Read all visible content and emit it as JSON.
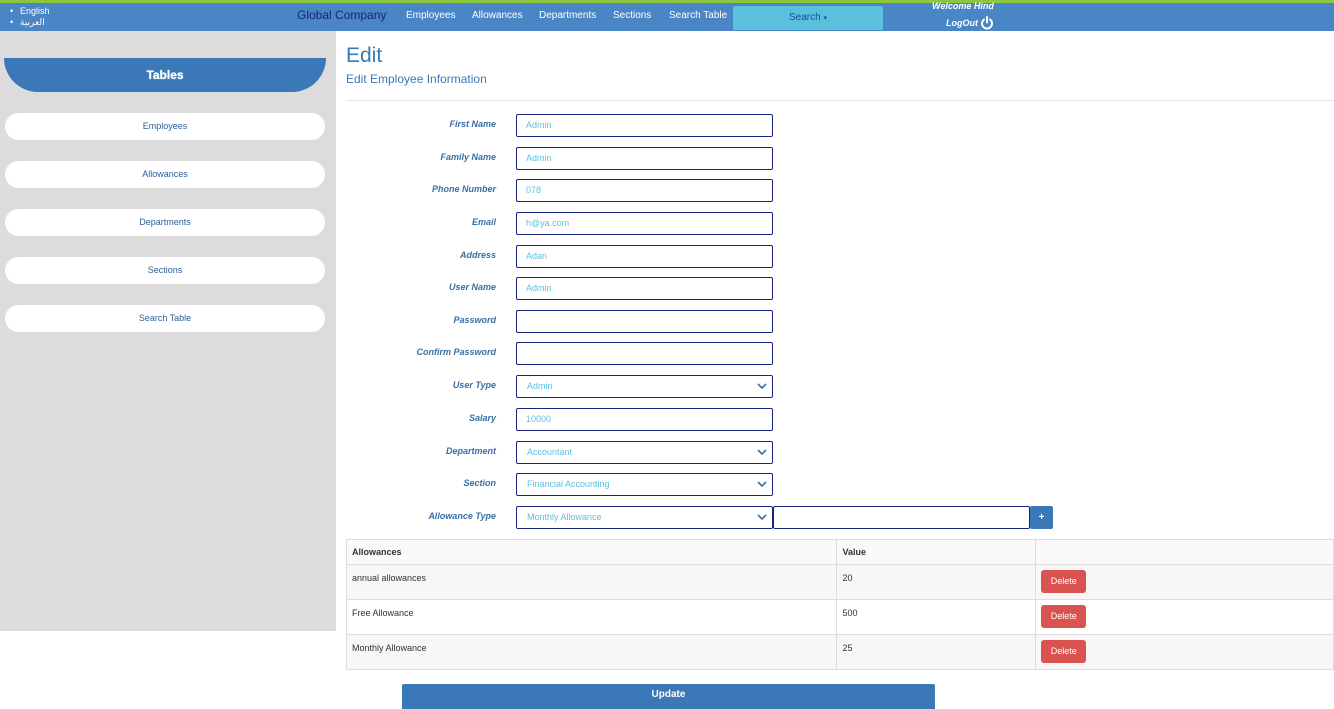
{
  "nav": {
    "languages": [
      "English",
      "العربية"
    ],
    "brand": "Global Company",
    "links": [
      "Employees",
      "Allowances",
      "Departments",
      "Sections",
      "Search Table"
    ],
    "search_label": "Search",
    "welcome": "Welcome Hind",
    "logout": "LogOut"
  },
  "sidebar": {
    "heading": "Tables",
    "items": [
      "Employees",
      "Allowances",
      "Departments",
      "Sections",
      "Search Table"
    ]
  },
  "page": {
    "title": "Edit",
    "subtitle": "Edit Employee Information"
  },
  "form": {
    "first_name": {
      "label": "First Name",
      "value": "Admin"
    },
    "family_name": {
      "label": "Family Name",
      "value": "Admin"
    },
    "phone_number": {
      "label": "Phone Number",
      "value": "078"
    },
    "email": {
      "label": "Email",
      "value": "h@ya.com"
    },
    "address": {
      "label": "Address",
      "value": "Adan"
    },
    "user_name": {
      "label": "User Name",
      "value": "Admin"
    },
    "password": {
      "label": "Password",
      "value": ""
    },
    "confirm_password": {
      "label": "Confirm Password",
      "value": ""
    },
    "user_type": {
      "label": "User Type",
      "value": "Admin"
    },
    "salary": {
      "label": "Salary",
      "value": "10000"
    },
    "department": {
      "label": "Department",
      "value": "Accountant"
    },
    "section": {
      "label": "Section",
      "value": "Financial Accounting"
    },
    "allowance_type": {
      "label": "Allowance Type",
      "value": "Monthly Allowance",
      "amount": "",
      "add_label": "+"
    }
  },
  "allowances_table": {
    "headers": [
      "Allowances",
      "Value",
      ""
    ],
    "rows": [
      {
        "name": "annual allowances",
        "value": "20",
        "action": "Delete"
      },
      {
        "name": "Free Allowance",
        "value": "500",
        "action": "Delete"
      },
      {
        "name": "Monthly Allowance",
        "value": "25",
        "action": "Delete"
      }
    ]
  },
  "update_label": "Update",
  "colors": {
    "topbar": "#4a86c5",
    "topbar_accent": "#8cc63f",
    "sidebar_bg": "#dcdcdc",
    "primary": "#3a78b8",
    "search": "#5bc0de",
    "danger": "#d9534f"
  }
}
